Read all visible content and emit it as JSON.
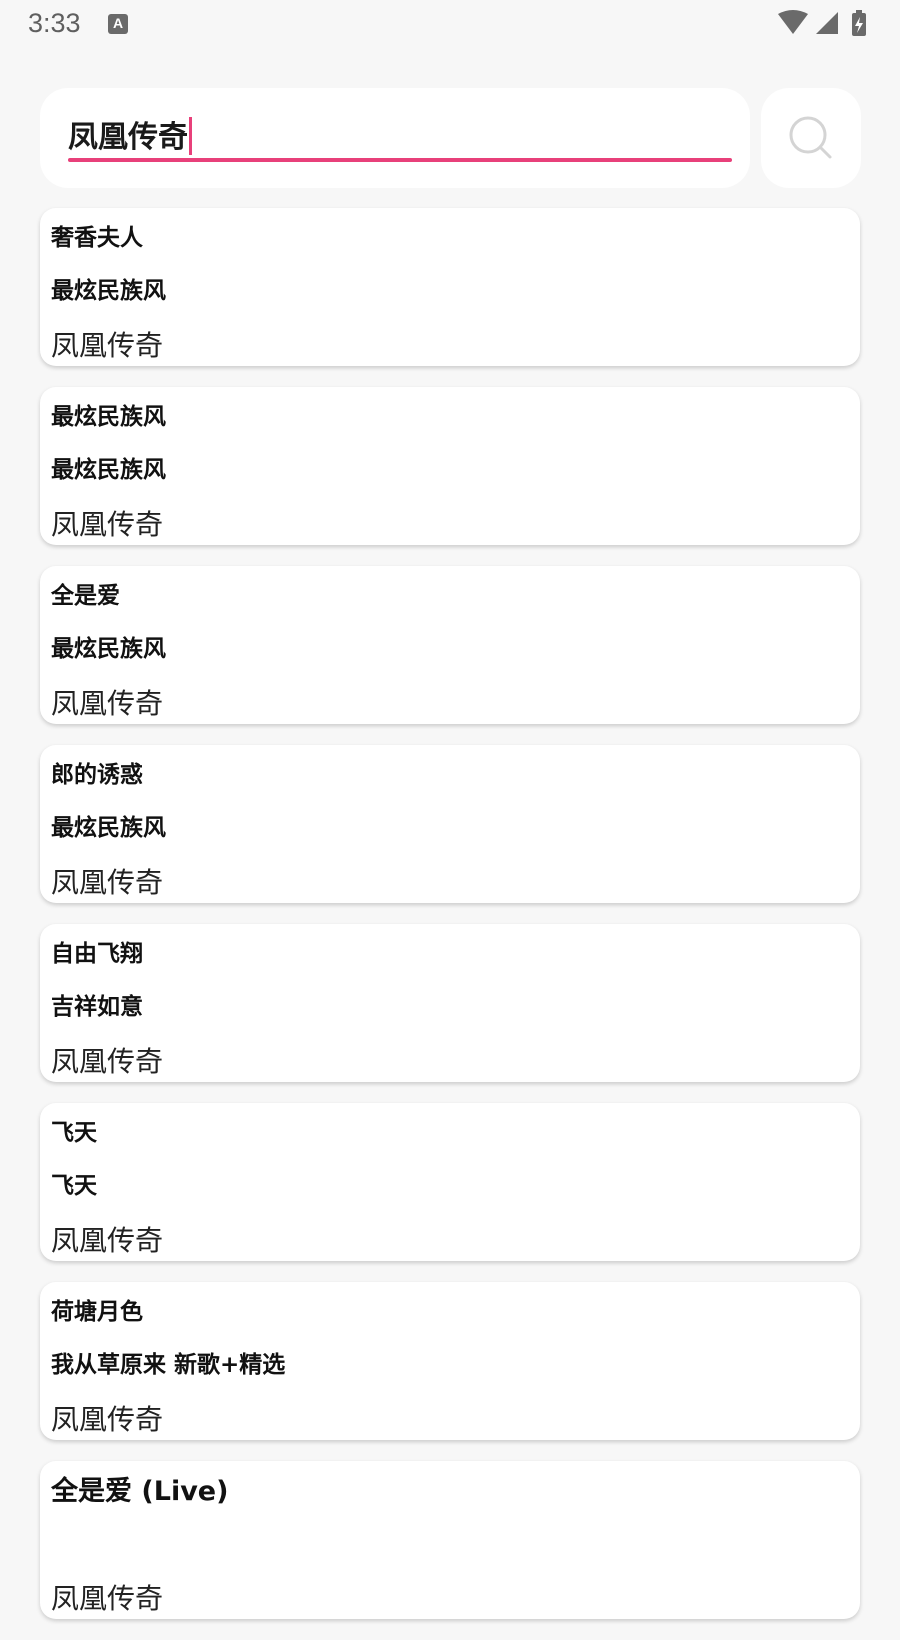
{
  "status_bar": {
    "time": "3:33",
    "notification_icon": "A",
    "icons": [
      "wifi-icon",
      "signal-icon",
      "battery-charging-icon"
    ]
  },
  "search": {
    "value": "凤凰传奇",
    "accent_color": "#e8407a",
    "button_icon": "search-icon"
  },
  "results": [
    {
      "title": "奢香夫人",
      "album": "最炫民族风",
      "artist": "凤凰传奇"
    },
    {
      "title": "最炫民族风",
      "album": "最炫民族风",
      "artist": "凤凰传奇"
    },
    {
      "title": "全是爱",
      "album": "最炫民族风",
      "artist": "凤凰传奇"
    },
    {
      "title": "郎的诱惑",
      "album": "最炫民族风",
      "artist": "凤凰传奇"
    },
    {
      "title": "自由飞翔",
      "album": "吉祥如意",
      "artist": "凤凰传奇"
    },
    {
      "title": "飞天",
      "album": "飞天",
      "artist": "凤凰传奇"
    },
    {
      "title": "荷塘月色",
      "album": "我从草原来 新歌+精选",
      "artist": "凤凰传奇"
    },
    {
      "title": "全是爱 (Live)",
      "album": "",
      "artist": "凤凰传奇"
    }
  ]
}
